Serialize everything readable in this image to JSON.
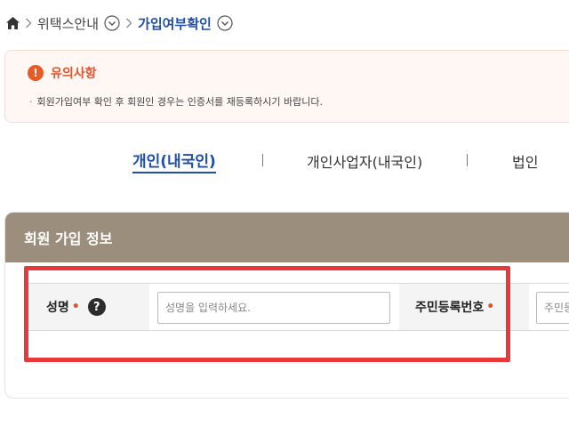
{
  "breadcrumb": {
    "items": [
      {
        "label": "위택스안내"
      },
      {
        "label": "가입여부확인"
      }
    ]
  },
  "notice": {
    "title": "유의사항",
    "text": "회원가입여부 확인 후 회원인 경우는 인증서를 재등록하시기 바랍니다."
  },
  "tabs": [
    {
      "label": "개인(내국인)",
      "active": true
    },
    {
      "label": "개인사업자(내국인)",
      "active": false
    },
    {
      "label": "법인",
      "active": false
    }
  ],
  "member_info": {
    "title": "회원 가입 정보",
    "name": {
      "label": "성명",
      "required_mark": "•",
      "help_icon": "?",
      "placeholder": "성명을 입력하세요.",
      "value": ""
    },
    "resident_number": {
      "label": "주민등록번호",
      "required_mark": "•",
      "placeholder": "주민등",
      "value": ""
    }
  },
  "colors": {
    "accent_blue": "#1d4ea8",
    "notice_orange": "#e0542b",
    "panel_header": "#9b8e7d",
    "highlight_red": "#e8383a"
  }
}
